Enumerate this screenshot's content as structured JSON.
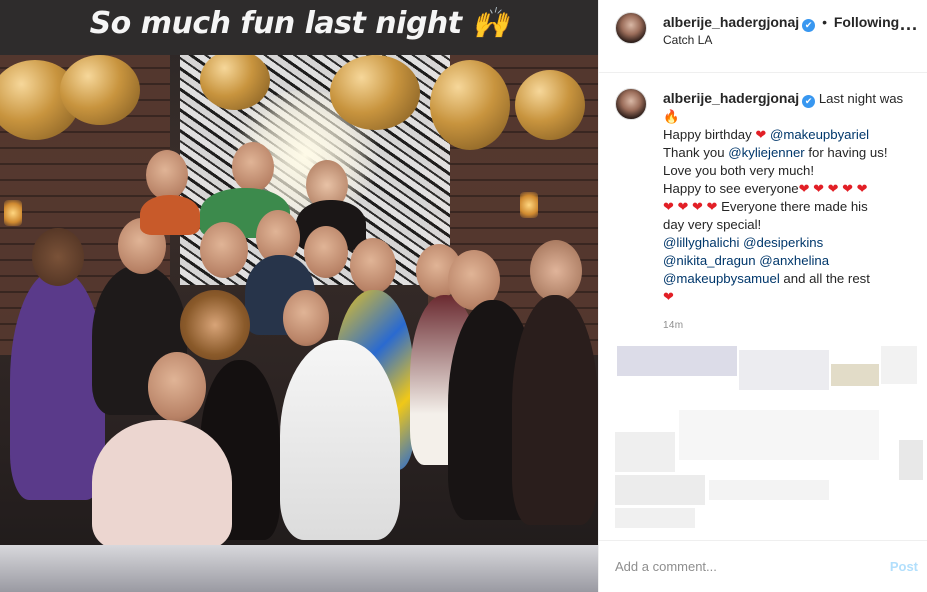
{
  "story": {
    "overlay_text": "So much fun last night",
    "overlay_emoji": "🙌"
  },
  "post": {
    "username": "alberije_hadergjonaj",
    "verified_glyph": "✔",
    "separator": "•",
    "follow_status": "Following",
    "location": "Catch LA",
    "more_label": "...",
    "caption_lines": [
      {
        "parts": [
          {
            "t": "Last night was",
            "k": "text"
          }
        ]
      },
      {
        "parts": [
          {
            "t": "🔥",
            "k": "fire"
          }
        ]
      },
      {
        "parts": [
          {
            "t": "Happy birthday ",
            "k": "text"
          },
          {
            "t": "❤",
            "k": "heart"
          },
          {
            "t": " @makeupbyariel",
            "k": "mention"
          }
        ]
      },
      {
        "parts": [
          {
            "t": "Thank you ",
            "k": "text"
          },
          {
            "t": "@kyliejenner",
            "k": "mention"
          },
          {
            "t": " for having us!",
            "k": "text"
          }
        ]
      },
      {
        "parts": [
          {
            "t": "Love you both very much!",
            "k": "text"
          }
        ]
      },
      {
        "parts": [
          {
            "t": "Happy to see everyone",
            "k": "text"
          },
          {
            "t": "❤ ❤ ❤ ❤ ❤",
            "k": "heart"
          }
        ]
      },
      {
        "parts": [
          {
            "t": "❤ ❤ ❤ ❤",
            "k": "heart"
          },
          {
            "t": " Everyone there made his",
            "k": "text"
          }
        ]
      },
      {
        "parts": [
          {
            "t": "day very special!",
            "k": "text"
          }
        ]
      },
      {
        "parts": [
          {
            "t": "@lillyghalichi",
            "k": "mention"
          },
          {
            "t": " ",
            "k": "text"
          },
          {
            "t": "@desiperkins",
            "k": "mention"
          }
        ]
      },
      {
        "parts": [
          {
            "t": "@nikita_dragun",
            "k": "mention"
          },
          {
            "t": " ",
            "k": "text"
          },
          {
            "t": "@anxhelina",
            "k": "mention"
          }
        ]
      },
      {
        "parts": [
          {
            "t": "@makeupbysamuel",
            "k": "mention"
          },
          {
            "t": " and all the rest",
            "k": "text"
          }
        ]
      },
      {
        "parts": [
          {
            "t": "❤",
            "k": "heart"
          }
        ]
      }
    ],
    "timestamp": "14m"
  },
  "comment_box": {
    "placeholder": "Add a comment...",
    "post_label": "Post"
  },
  "colors": {
    "link": "#00376b",
    "verified": "#3897f0",
    "heart": "#e21f26",
    "post_button_disabled": "#b2dffc"
  }
}
